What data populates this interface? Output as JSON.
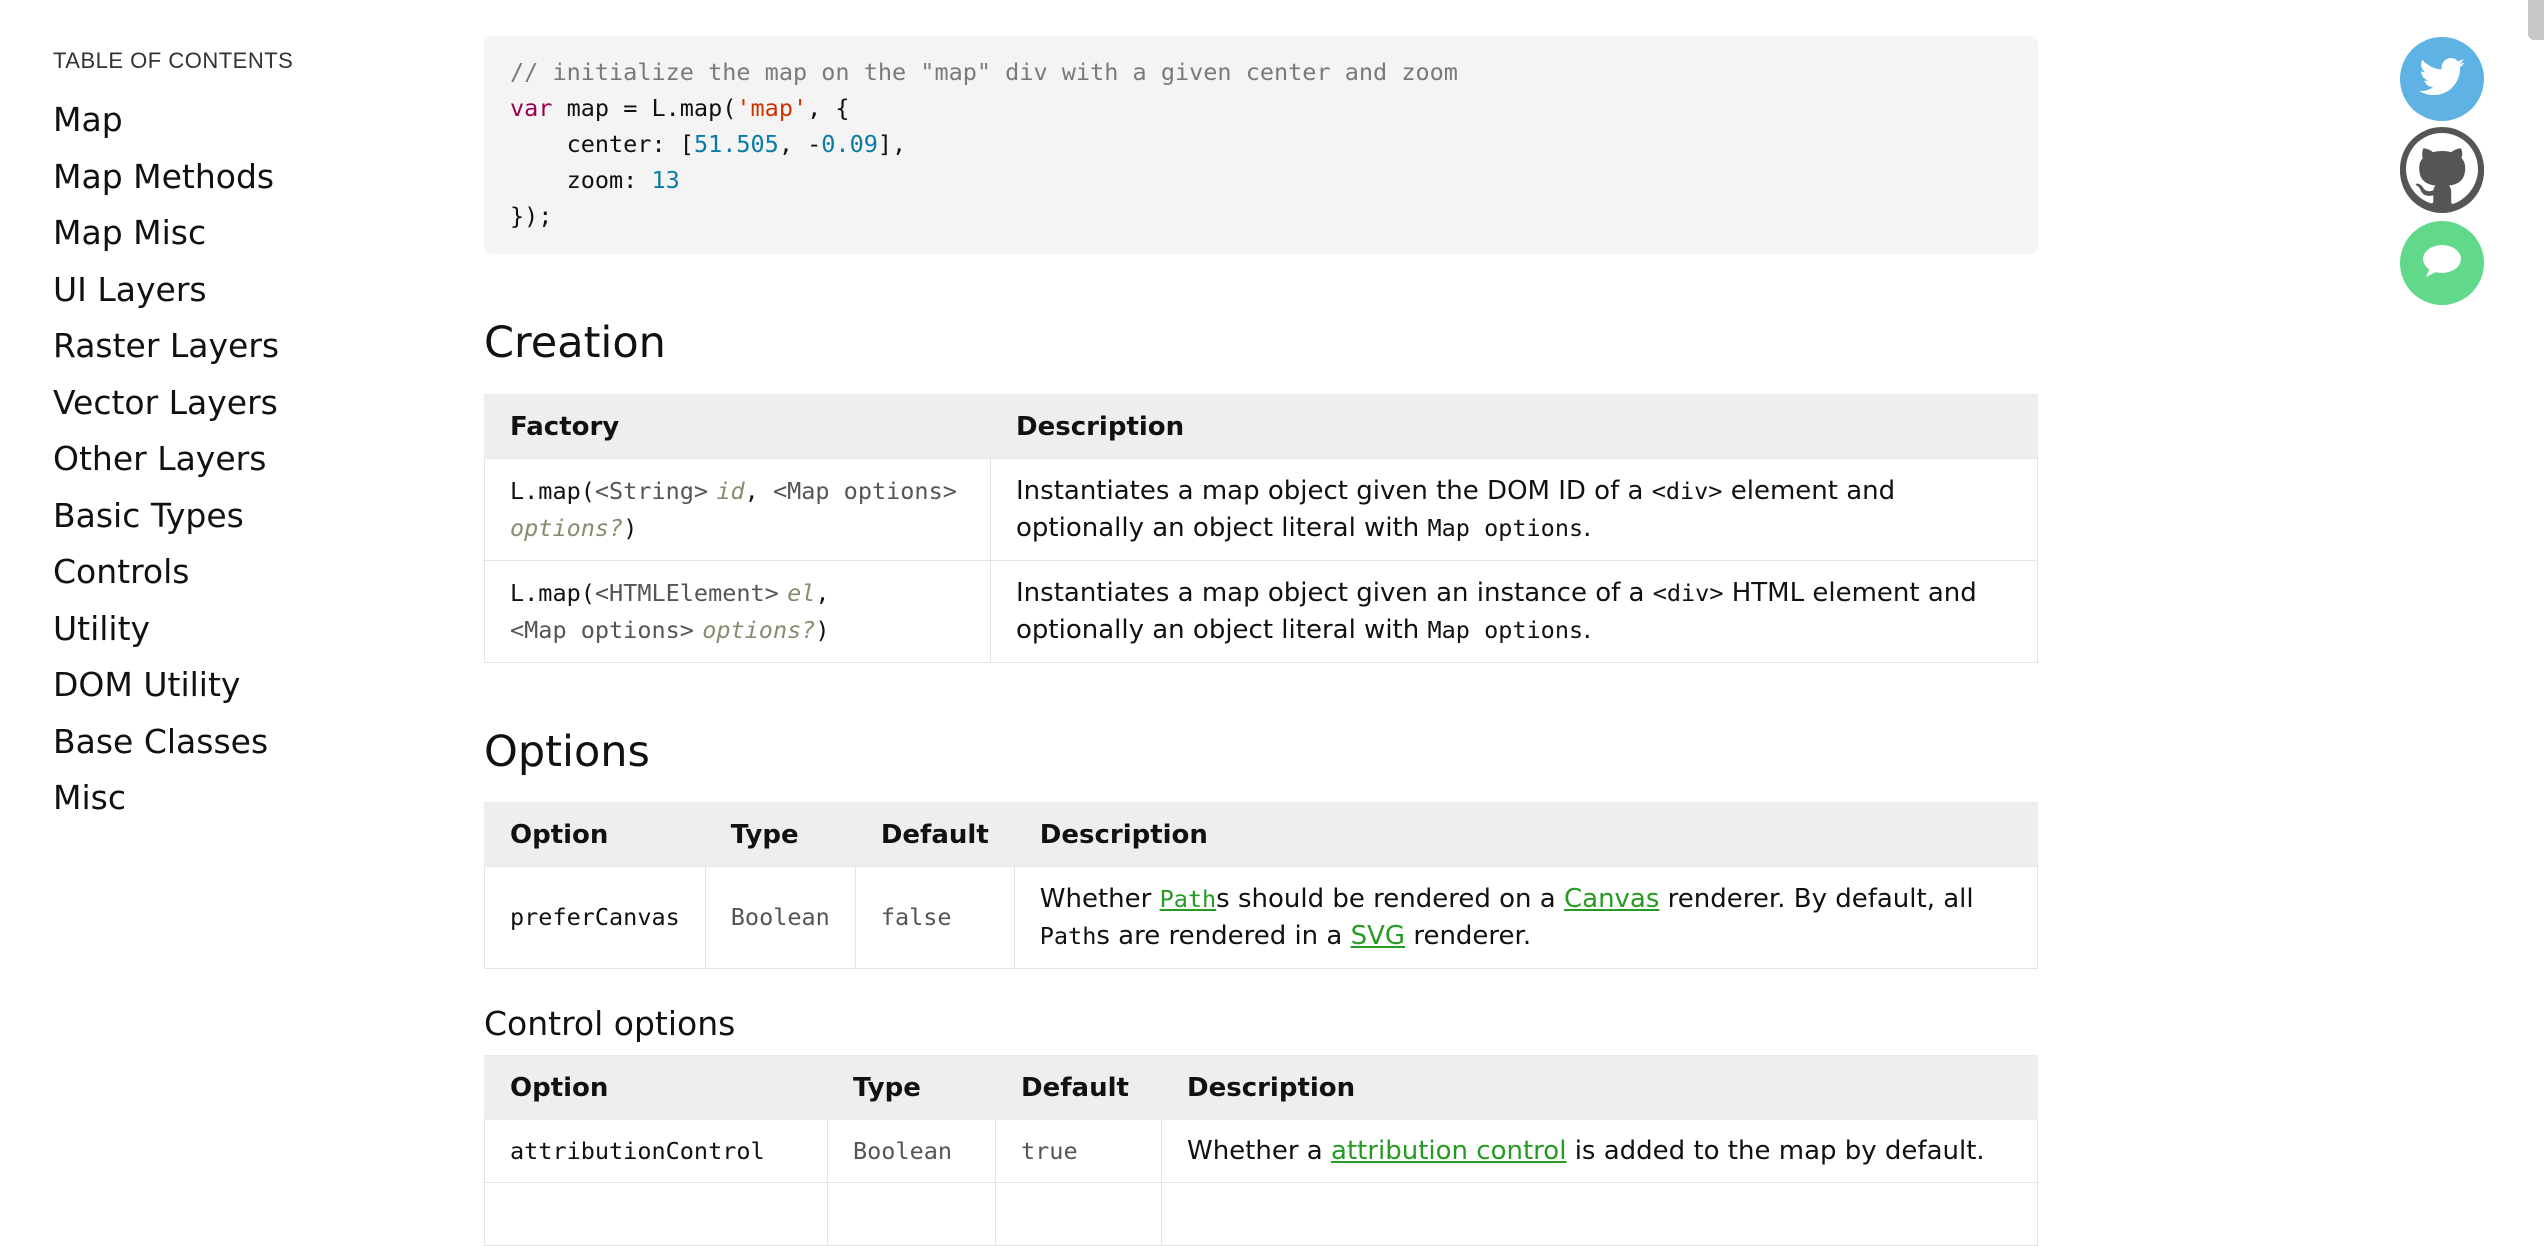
{
  "sidebar": {
    "heading": "TABLE OF CONTENTS",
    "items": [
      {
        "label": "Map"
      },
      {
        "label": "Map Methods"
      },
      {
        "label": "Map Misc"
      },
      {
        "label": "UI Layers"
      },
      {
        "label": "Raster Layers"
      },
      {
        "label": "Vector Layers"
      },
      {
        "label": "Other Layers"
      },
      {
        "label": "Basic Types"
      },
      {
        "label": "Controls"
      },
      {
        "label": "Utility"
      },
      {
        "label": "DOM Utility"
      },
      {
        "label": "Base Classes"
      },
      {
        "label": "Misc"
      }
    ]
  },
  "code": {
    "comment": "// initialize the map on the \"map\" div with a given center and zoom",
    "kw_var": "var",
    "l2_a": " map = L.map(",
    "l2_str": "'map'",
    "l2_b": ", {",
    "l3_a": "    center: [",
    "l3_n1": "51.505",
    "l3_b": ", -",
    "l3_n2": "0.09",
    "l3_c": "],",
    "l4_a": "    zoom: ",
    "l4_n": "13",
    "l5": "});"
  },
  "creation": {
    "heading": "Creation",
    "col_factory": "Factory",
    "col_description": "Description",
    "rows": [
      {
        "f_call": "L.map(",
        "f_t1": "<String>",
        "f_p1": "id",
        "f_sep": ", ",
        "f_t2": "<Map options>",
        "f_p2": "options?",
        "f_end": ")",
        "d_a": "Instantiates a map object given the DOM ID of a ",
        "d_code1": "<div>",
        "d_b": " element and optionally an object literal with ",
        "d_code2": "Map options",
        "d_c": "."
      },
      {
        "f_call": "L.map(",
        "f_t1": "<HTMLElement>",
        "f_p1": "el",
        "f_sep": ",",
        "f_t2": "<Map options>",
        "f_p2": "options?",
        "f_end": ")",
        "d_a": "Instantiates a map object given an instance of a ",
        "d_code1": "<div>",
        "d_b": " HTML element and optionally an object literal with ",
        "d_code2": "Map options",
        "d_c": "."
      }
    ]
  },
  "options": {
    "heading": "Options",
    "col_option": "Option",
    "col_type": "Type",
    "col_default": "Default",
    "col_description": "Description",
    "row": {
      "option": "preferCanvas",
      "type": "Boolean",
      "default": "false",
      "d_a": "Whether ",
      "link_path": "Path",
      "d_b": "s should be rendered on a ",
      "link_canvas": "Canvas",
      "d_c": " renderer. By default, all ",
      "d_code": "Path",
      "d_d": "s are rendered in a ",
      "link_svg": "SVG",
      "d_e": " renderer."
    }
  },
  "control_options": {
    "heading": "Control options",
    "col_option": "Option",
    "col_type": "Type",
    "col_default": "Default",
    "col_description": "Description",
    "row": {
      "option": "attributionControl",
      "type": "Boolean",
      "default": "true",
      "d_a": "Whether a ",
      "link": "attribution control",
      "d_b": " is added to the map by default."
    }
  },
  "social": [
    {
      "icon": "twitter-icon",
      "color": "#5eb3e4"
    },
    {
      "icon": "github-icon",
      "color": "#555555"
    },
    {
      "icon": "chat-icon",
      "color": "#62d98a"
    }
  ]
}
